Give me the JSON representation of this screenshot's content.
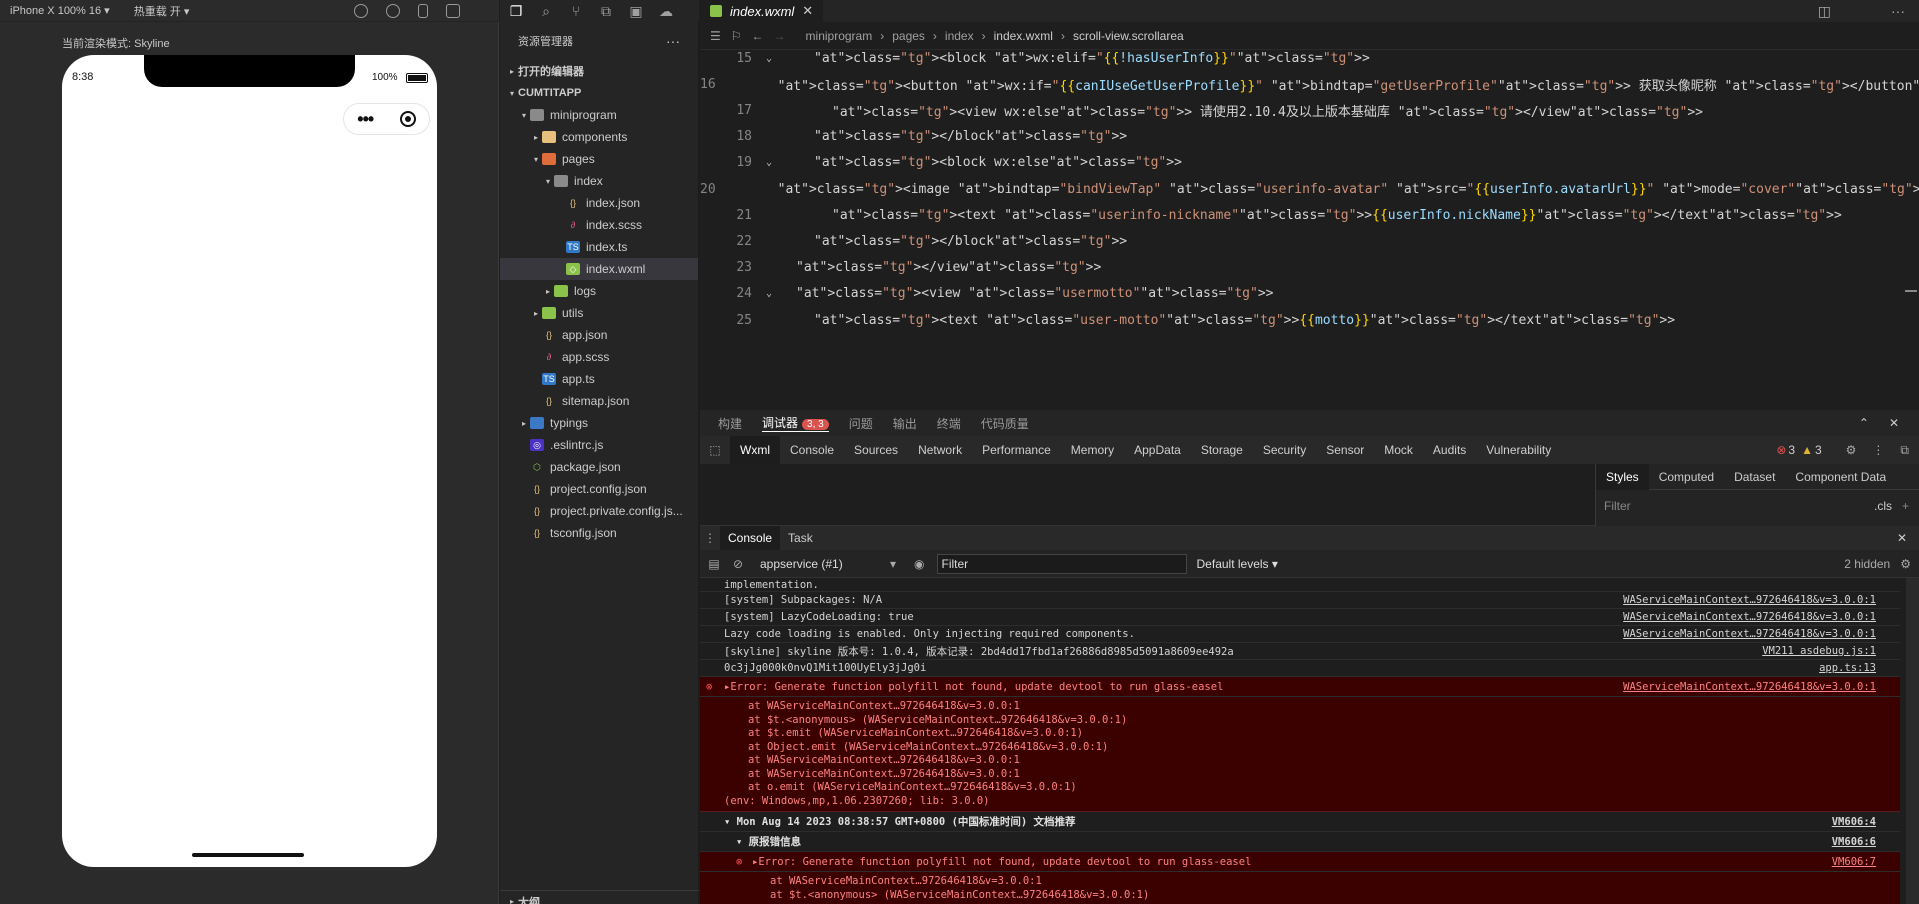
{
  "simulator": {
    "device": "iPhone X 100% 16 ▾",
    "hotreload": "热重载 开 ▾",
    "render_mode": "当前渲染模式: Skyline",
    "time": "8:38",
    "battery": "100%"
  },
  "explorer": {
    "title": "资源管理器",
    "more": "···",
    "open_editors": "打开的编辑器",
    "project": "CUMTITAPP",
    "tree": [
      {
        "name": "miniprogram",
        "depth": 1,
        "type": "folder",
        "open": true
      },
      {
        "name": "components",
        "depth": 2,
        "type": "folder",
        "open": false
      },
      {
        "name": "pages",
        "depth": 2,
        "type": "folder",
        "open": true
      },
      {
        "name": "index",
        "depth": 3,
        "type": "folder",
        "open": true
      },
      {
        "name": "index.json",
        "depth": 4,
        "type": "json"
      },
      {
        "name": "index.scss",
        "depth": 4,
        "type": "scss"
      },
      {
        "name": "index.ts",
        "depth": 4,
        "type": "ts"
      },
      {
        "name": "index.wxml",
        "depth": 4,
        "type": "wxml",
        "selected": true
      },
      {
        "name": "logs",
        "depth": 3,
        "type": "folder",
        "open": false
      },
      {
        "name": "utils",
        "depth": 2,
        "type": "folder",
        "open": false
      },
      {
        "name": "app.json",
        "depth": 2,
        "type": "json"
      },
      {
        "name": "app.scss",
        "depth": 2,
        "type": "scss"
      },
      {
        "name": "app.ts",
        "depth": 2,
        "type": "ts"
      },
      {
        "name": "sitemap.json",
        "depth": 2,
        "type": "json"
      },
      {
        "name": "typings",
        "depth": 1,
        "type": "folder",
        "open": false
      },
      {
        "name": ".eslintrc.js",
        "depth": 1,
        "type": "eslint"
      },
      {
        "name": "package.json",
        "depth": 1,
        "type": "npm"
      },
      {
        "name": "project.config.json",
        "depth": 1,
        "type": "json"
      },
      {
        "name": "project.private.config.js...",
        "depth": 1,
        "type": "json"
      },
      {
        "name": "tsconfig.json",
        "depth": 1,
        "type": "json"
      }
    ],
    "outline": "大纲"
  },
  "editor": {
    "tab_name": "index.wxml",
    "breadcrumb": [
      "miniprogram",
      "pages",
      "index",
      "index.wxml",
      "scroll-view.scrollarea"
    ],
    "lines": [
      {
        "n": "15",
        "fold": true,
        "indent": 2,
        "code": "<block wx:elif=\"{{!hasUserInfo}}\">"
      },
      {
        "n": "16",
        "fold": false,
        "indent": 3,
        "code": "<button wx:if=\"{{canIUseGetUserProfile}}\" bindtap=\"getUserProfile\"> 获取头像昵称 </button>"
      },
      {
        "n": "17",
        "fold": false,
        "indent": 3,
        "code": "<view wx:else> 请使用2.10.4及以上版本基础库 </view>"
      },
      {
        "n": "18",
        "fold": false,
        "indent": 2,
        "code": "</block>"
      },
      {
        "n": "19",
        "fold": true,
        "indent": 2,
        "code": "<block wx:else>"
      },
      {
        "n": "20",
        "fold": false,
        "indent": 3,
        "code": "<image bindtap=\"bindViewTap\" class=\"userinfo-avatar\" src=\"{{userInfo.avatarUrl}}\" mode=\"cover\"></image>"
      },
      {
        "n": "21",
        "fold": false,
        "indent": 3,
        "code": "<text class=\"userinfo-nickname\">{{userInfo.nickName}}</text>"
      },
      {
        "n": "22",
        "fold": false,
        "indent": 2,
        "code": "</block>"
      },
      {
        "n": "23",
        "fold": false,
        "indent": 1,
        "code": "</view>"
      },
      {
        "n": "24",
        "fold": true,
        "indent": 1,
        "code": "<view class=\"usermotto\">"
      },
      {
        "n": "25",
        "fold": false,
        "indent": 2,
        "code": "<text class=\"user-motto\">{{motto}}</text>"
      }
    ]
  },
  "panel": {
    "tabs": [
      "构建",
      "调试器",
      "问题",
      "输出",
      "终端",
      "代码质量"
    ],
    "debugger_badge": "3, 3",
    "devtools_tabs": [
      "Wxml",
      "Console",
      "Sources",
      "Network",
      "Performance",
      "Memory",
      "AppData",
      "Storage",
      "Security",
      "Sensor",
      "Mock",
      "Audits",
      "Vulnerability"
    ],
    "error_count": "3",
    "warn_count": "3",
    "styles_tabs": [
      "Styles",
      "Computed",
      "Dataset",
      "Component Data"
    ],
    "styles_filter": "Filter",
    "cls": ".cls",
    "console_tabs": [
      "Console",
      "Task"
    ],
    "context": "appservice (#1)",
    "filter_placeholder": "Filter",
    "levels": "Default levels ▾",
    "hidden": "2 hidden"
  },
  "console": {
    "logs": [
      {
        "text": "implementation.",
        "src": ""
      },
      {
        "text": "[system] Subpackages: N/A",
        "src": "WAServiceMainContext…972646418&v=3.0.0:1"
      },
      {
        "text": "[system] LazyCodeLoading: true",
        "src": "WAServiceMainContext…972646418&v=3.0.0:1"
      },
      {
        "text": "Lazy code loading is enabled. Only injecting required components.",
        "src": "WAServiceMainContext…972646418&v=3.0.0:1"
      },
      {
        "text": "[skyline] skyline 版本号: 1.0.4, 版本记录: 2bd4dd17fbd1af26886d8985d5091a8609ee492a",
        "src": "VM211 asdebug.js:1"
      },
      {
        "text": "0c3jJg000k0nvQ1Mit100UyEly3jJg0i",
        "src": "app.ts:13"
      }
    ],
    "error1": {
      "head": "▸Error: Generate function polyfill not found, update devtool to run glass-easel",
      "src": "WAServiceMainContext…972646418&v=3.0.0:1",
      "stack": [
        "at WAServiceMainContext…972646418&v=3.0.0:1",
        "at $t.<anonymous> (WAServiceMainContext…972646418&v=3.0.0:1)",
        "at $t.emit (WAServiceMainContext…972646418&v=3.0.0:1)",
        "at Object.emit (WAServiceMainContext…972646418&v=3.0.0:1)",
        "at WAServiceMainContext…972646418&v=3.0.0:1",
        "at WAServiceMainContext…972646418&v=3.0.0:1",
        "at o.emit (WAServiceMainContext…972646418&v=3.0.0:1)"
      ],
      "env": "(env: Windows,mp,1.06.2307260; lib: 3.0.0)"
    },
    "group1": {
      "text": "▾ Mon Aug 14 2023 08:38:57 GMT+0800 (中国标准时间) 文档推荐",
      "src": "VM606:4"
    },
    "group2": {
      "text": "▾ 原报错信息",
      "src": "VM606:6"
    },
    "error2": {
      "head": "▸Error: Generate function polyfill not found, update devtool to run glass-easel",
      "src": "VM606:7",
      "stack": [
        "at WAServiceMainContext…972646418&v=3.0.0:1",
        "at $t.<anonymous> (WAServiceMainContext…972646418&v=3.0.0:1)"
      ]
    }
  }
}
